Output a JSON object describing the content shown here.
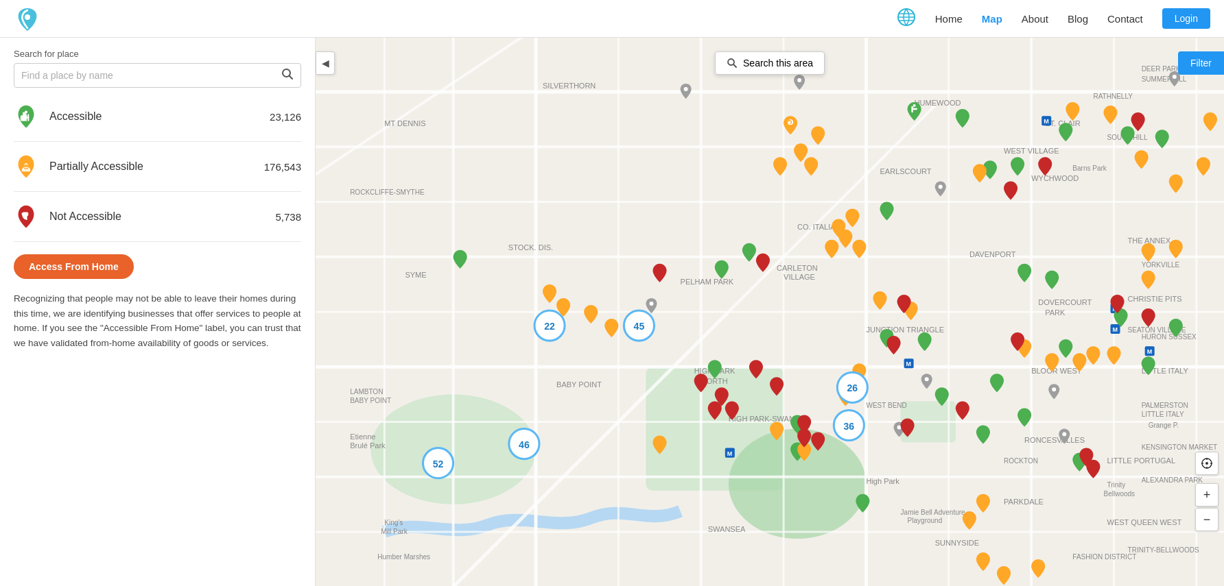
{
  "header": {
    "logo_alt": "AccessNow Logo",
    "nav": [
      {
        "label": "Home",
        "active": false
      },
      {
        "label": "Map",
        "active": true
      },
      {
        "label": "About",
        "active": false
      },
      {
        "label": "Blog",
        "active": false
      },
      {
        "label": "Contact",
        "active": false
      }
    ],
    "login_label": "Login"
  },
  "sidebar": {
    "search_label": "Search for place",
    "search_placeholder": "Find a place by name",
    "legend": [
      {
        "type": "accessible",
        "label": "Accessible",
        "count": "23,126",
        "color": "#4caf50"
      },
      {
        "type": "partial",
        "label": "Partially Accessible",
        "count": "176,543",
        "color": "#ffa726"
      },
      {
        "type": "not",
        "label": "Not Accessible",
        "count": "5,738",
        "color": "#c62828"
      }
    ],
    "access_home_label": "Access From Home",
    "description": "Recognizing that people may not be able to leave their homes during this time, we are identifying businesses that offer services to people at home. If you see the \"Accessible From Home\" label, you can trust that we have validated from-home availability of goods or services."
  },
  "map": {
    "search_area_label": "Search this area",
    "filter_label": "Filter",
    "collapse_icon": "◀",
    "clusters": [
      {
        "id": "c1",
        "count": "22",
        "left": "26%",
        "top": "53%"
      },
      {
        "id": "c2",
        "count": "45",
        "left": "36%",
        "top": "53%"
      },
      {
        "id": "c3",
        "count": "26",
        "left": "59%",
        "top": "63%"
      },
      {
        "id": "c4",
        "count": "36",
        "left": "59%",
        "top": "70%"
      },
      {
        "id": "c5",
        "count": "46",
        "left": "23%",
        "top": "74%"
      },
      {
        "id": "c6",
        "count": "52",
        "left": "14%",
        "top": "79%"
      }
    ],
    "zoom_in": "+",
    "zoom_out": "−",
    "locate_icon": "⊕"
  }
}
